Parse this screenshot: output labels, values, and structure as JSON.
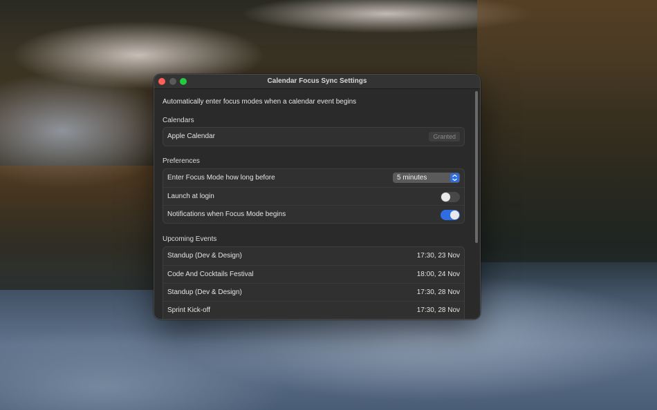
{
  "window": {
    "title": "Calendar Focus Sync Settings",
    "accent_color": "#2f6ee0"
  },
  "intro": "Automatically enter focus modes when a calendar event begins",
  "calendars": {
    "title": "Calendars",
    "items": [
      {
        "name": "Apple Calendar",
        "status": "Granted"
      }
    ]
  },
  "preferences": {
    "title": "Preferences",
    "focus_before": {
      "label": "Enter Focus Mode how long before",
      "value": "5 minutes"
    },
    "launch_at_login": {
      "label": "Launch at login",
      "enabled": false
    },
    "notifications": {
      "label": "Notifications when Focus Mode begins",
      "enabled": true
    }
  },
  "upcoming": {
    "title": "Upcoming Events",
    "events": [
      {
        "name": "Standup (Dev & Design)",
        "time": "17:30, 23 Nov"
      },
      {
        "name": "Code And Cocktails Festival",
        "time": "18:00, 24 Nov"
      },
      {
        "name": "Standup (Dev & Design)",
        "time": "17:30, 28 Nov"
      },
      {
        "name": "Sprint Kick-off",
        "time": "17:30, 28 Nov"
      }
    ]
  }
}
